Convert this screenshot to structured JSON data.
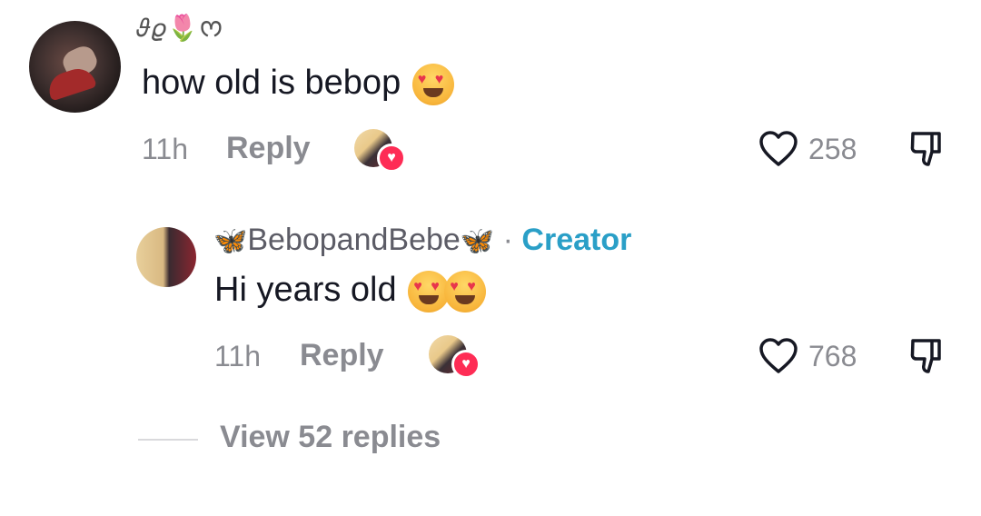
{
  "comment": {
    "username_decoration": "𝜗𝜚🌷ᰔ",
    "text": "how old is bebop",
    "time": "11h",
    "reply_label": "Reply",
    "like_count": "258"
  },
  "reply": {
    "username": "BebopandBebe",
    "butterfly_left": "🦋",
    "butterfly_right": "🦋",
    "separator": "·",
    "creator_label": "Creator",
    "text": "Hi years old",
    "time": "11h",
    "reply_label": "Reply",
    "like_count": "768"
  },
  "view_replies": "View 52 replies",
  "colors": {
    "like_heart_badge": "#fe2c55",
    "creator_blue": "#2a9fc7",
    "meta_gray": "#8a8b91"
  }
}
